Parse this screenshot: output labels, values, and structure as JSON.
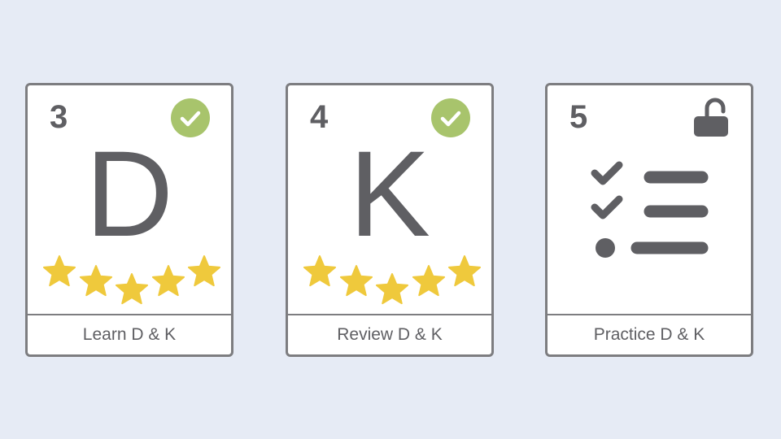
{
  "colors": {
    "background": "#e6ebf5",
    "card_border": "#7d7d80",
    "text": "#5f5f63",
    "check_badge": "#a8c46c",
    "star": "#efc93c"
  },
  "cards": [
    {
      "number": "3",
      "letter": "D",
      "label": "Learn D & K",
      "status": "completed",
      "status_icon": "check-circle-icon",
      "stars": 5
    },
    {
      "number": "4",
      "letter": "K",
      "label": "Review D & K",
      "status": "completed",
      "status_icon": "check-circle-icon",
      "stars": 5
    },
    {
      "number": "5",
      "letter": "",
      "label": "Practice D & K",
      "status": "unlocked",
      "status_icon": "unlocked-padlock-icon",
      "content_icon": "checklist-icon",
      "stars": 0
    }
  ]
}
